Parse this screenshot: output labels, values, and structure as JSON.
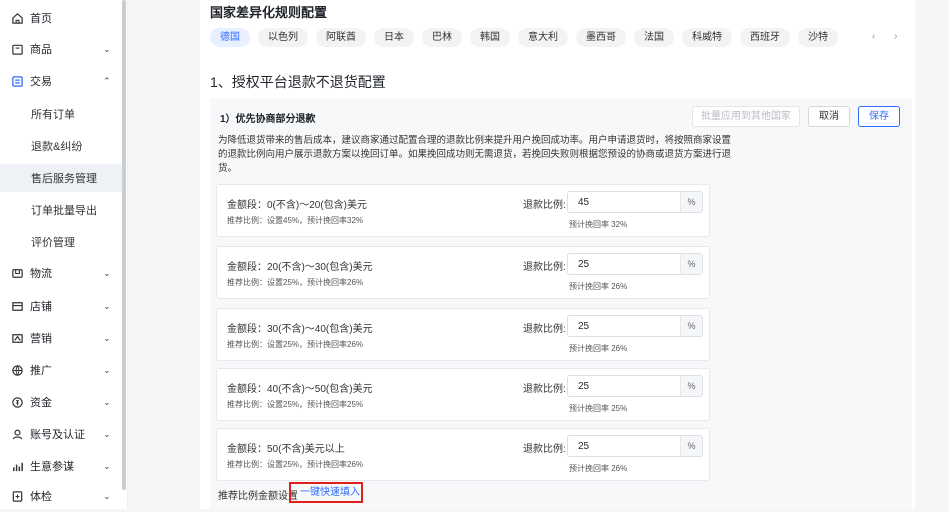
{
  "sidebar": {
    "items": [
      {
        "label": "首页",
        "icon": "home-icon",
        "chevron": ""
      },
      {
        "label": "商品",
        "icon": "product-icon",
        "chevron": "⌄"
      },
      {
        "label": "交易",
        "icon": "order-icon",
        "chevron": "⌃"
      },
      {
        "label": "物流",
        "icon": "truck-icon",
        "chevron": "⌄"
      },
      {
        "label": "店铺",
        "icon": "shop-icon",
        "chevron": "⌄"
      },
      {
        "label": "营销",
        "icon": "marketing-icon",
        "chevron": "⌄"
      },
      {
        "label": "推广",
        "icon": "promotion-icon",
        "chevron": "⌄"
      },
      {
        "label": "资金",
        "icon": "money-icon",
        "chevron": "⌄"
      },
      {
        "label": "账号及认证",
        "icon": "user-icon",
        "chevron": "⌄"
      },
      {
        "label": "生意参谋",
        "icon": "analytics-icon",
        "chevron": "⌄"
      },
      {
        "label": "体检",
        "icon": "checkup-icon",
        "chevron": "⌄"
      }
    ],
    "trade_sub": [
      "所有订单",
      "退款&纠纷",
      "售后服务管理",
      "订单批量导出",
      "评价管理"
    ],
    "selected_sub": "售后服务管理"
  },
  "main": {
    "country_title": "国家差异化规则配置",
    "tabs": [
      "德国",
      "以色列",
      "阿联酋",
      "日本",
      "巴林",
      "韩国",
      "意大利",
      "墨西哥",
      "法国",
      "科威特",
      "西班牙",
      "沙特"
    ],
    "active_tab": "德国",
    "tab_arrows": "‹ ›",
    "section_title": "1、授权平台退款不退货配置",
    "panel": {
      "head": "1）优先协商部分退款",
      "batch_button": "批量应用到其他国家",
      "cancel_button": "取消",
      "save_button": "保存",
      "description": "为降低退货带来的售后成本，建议商家通过配置合理的退款比例来提升用户挽回成功率。用户申请退货时，将按照商家设置的退款比例向用户展示退款方案以挽回订单。如果挽回成功则无需退货，若挽回失败则根据您预设的协商或退货方案进行退货。",
      "ratio_label": "退款比例:",
      "pct_unit": "%",
      "rows": [
        {
          "range": "金额段：0(不含)～20(包含)美元",
          "tip": "推荐比例：设置45%，预计挽回率32%",
          "value": "45",
          "estimate": "预计挽回率 32%"
        },
        {
          "range": "金额段：20(不含)～30(包含)美元",
          "tip": "推荐比例：设置25%，预计挽回率26%",
          "value": "25",
          "estimate": "预计挽回率 26%"
        },
        {
          "range": "金额段：30(不含)～40(包含)美元",
          "tip": "推荐比例：设置25%，预计挽回率26%",
          "value": "25",
          "estimate": "预计挽回率 26%"
        },
        {
          "range": "金额段：40(不含)～50(包含)美元",
          "tip": "推荐比例：设置25%，预计挽回率25%",
          "value": "25",
          "estimate": "预计挽回率 25%"
        },
        {
          "range": "金额段：50(不含)美元以上",
          "tip": "推荐比例：设置25%，预计挽回率26%",
          "value": "25",
          "estimate": "预计挽回率 26%"
        }
      ],
      "footer_text": "推荐比例金额设置",
      "quick_fill": "一键快速填入"
    }
  },
  "colors": {
    "accent": "#2f6bff",
    "highlight_border": "#e0201a"
  }
}
